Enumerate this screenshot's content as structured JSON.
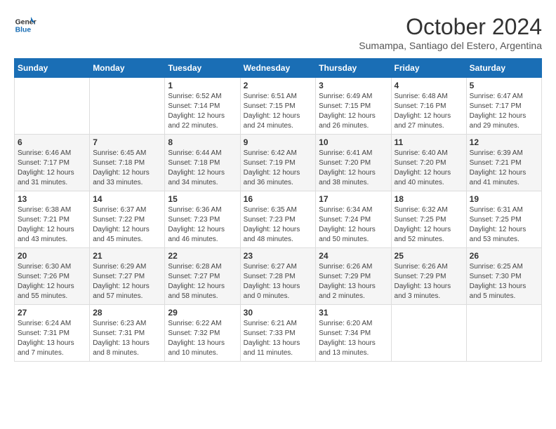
{
  "logo": {
    "text_general": "General",
    "text_blue": "Blue"
  },
  "header": {
    "month": "October 2024",
    "location": "Sumampa, Santiago del Estero, Argentina"
  },
  "weekdays": [
    "Sunday",
    "Monday",
    "Tuesday",
    "Wednesday",
    "Thursday",
    "Friday",
    "Saturday"
  ],
  "weeks": [
    [
      {
        "day": "",
        "info": ""
      },
      {
        "day": "",
        "info": ""
      },
      {
        "day": "1",
        "info": "Sunrise: 6:52 AM\nSunset: 7:14 PM\nDaylight: 12 hours and 22 minutes."
      },
      {
        "day": "2",
        "info": "Sunrise: 6:51 AM\nSunset: 7:15 PM\nDaylight: 12 hours and 24 minutes."
      },
      {
        "day": "3",
        "info": "Sunrise: 6:49 AM\nSunset: 7:15 PM\nDaylight: 12 hours and 26 minutes."
      },
      {
        "day": "4",
        "info": "Sunrise: 6:48 AM\nSunset: 7:16 PM\nDaylight: 12 hours and 27 minutes."
      },
      {
        "day": "5",
        "info": "Sunrise: 6:47 AM\nSunset: 7:17 PM\nDaylight: 12 hours and 29 minutes."
      }
    ],
    [
      {
        "day": "6",
        "info": "Sunrise: 6:46 AM\nSunset: 7:17 PM\nDaylight: 12 hours and 31 minutes."
      },
      {
        "day": "7",
        "info": "Sunrise: 6:45 AM\nSunset: 7:18 PM\nDaylight: 12 hours and 33 minutes."
      },
      {
        "day": "8",
        "info": "Sunrise: 6:44 AM\nSunset: 7:18 PM\nDaylight: 12 hours and 34 minutes."
      },
      {
        "day": "9",
        "info": "Sunrise: 6:42 AM\nSunset: 7:19 PM\nDaylight: 12 hours and 36 minutes."
      },
      {
        "day": "10",
        "info": "Sunrise: 6:41 AM\nSunset: 7:20 PM\nDaylight: 12 hours and 38 minutes."
      },
      {
        "day": "11",
        "info": "Sunrise: 6:40 AM\nSunset: 7:20 PM\nDaylight: 12 hours and 40 minutes."
      },
      {
        "day": "12",
        "info": "Sunrise: 6:39 AM\nSunset: 7:21 PM\nDaylight: 12 hours and 41 minutes."
      }
    ],
    [
      {
        "day": "13",
        "info": "Sunrise: 6:38 AM\nSunset: 7:21 PM\nDaylight: 12 hours and 43 minutes."
      },
      {
        "day": "14",
        "info": "Sunrise: 6:37 AM\nSunset: 7:22 PM\nDaylight: 12 hours and 45 minutes."
      },
      {
        "day": "15",
        "info": "Sunrise: 6:36 AM\nSunset: 7:23 PM\nDaylight: 12 hours and 46 minutes."
      },
      {
        "day": "16",
        "info": "Sunrise: 6:35 AM\nSunset: 7:23 PM\nDaylight: 12 hours and 48 minutes."
      },
      {
        "day": "17",
        "info": "Sunrise: 6:34 AM\nSunset: 7:24 PM\nDaylight: 12 hours and 50 minutes."
      },
      {
        "day": "18",
        "info": "Sunrise: 6:32 AM\nSunset: 7:25 PM\nDaylight: 12 hours and 52 minutes."
      },
      {
        "day": "19",
        "info": "Sunrise: 6:31 AM\nSunset: 7:25 PM\nDaylight: 12 hours and 53 minutes."
      }
    ],
    [
      {
        "day": "20",
        "info": "Sunrise: 6:30 AM\nSunset: 7:26 PM\nDaylight: 12 hours and 55 minutes."
      },
      {
        "day": "21",
        "info": "Sunrise: 6:29 AM\nSunset: 7:27 PM\nDaylight: 12 hours and 57 minutes."
      },
      {
        "day": "22",
        "info": "Sunrise: 6:28 AM\nSunset: 7:27 PM\nDaylight: 12 hours and 58 minutes."
      },
      {
        "day": "23",
        "info": "Sunrise: 6:27 AM\nSunset: 7:28 PM\nDaylight: 13 hours and 0 minutes."
      },
      {
        "day": "24",
        "info": "Sunrise: 6:26 AM\nSunset: 7:29 PM\nDaylight: 13 hours and 2 minutes."
      },
      {
        "day": "25",
        "info": "Sunrise: 6:26 AM\nSunset: 7:29 PM\nDaylight: 13 hours and 3 minutes."
      },
      {
        "day": "26",
        "info": "Sunrise: 6:25 AM\nSunset: 7:30 PM\nDaylight: 13 hours and 5 minutes."
      }
    ],
    [
      {
        "day": "27",
        "info": "Sunrise: 6:24 AM\nSunset: 7:31 PM\nDaylight: 13 hours and 7 minutes."
      },
      {
        "day": "28",
        "info": "Sunrise: 6:23 AM\nSunset: 7:31 PM\nDaylight: 13 hours and 8 minutes."
      },
      {
        "day": "29",
        "info": "Sunrise: 6:22 AM\nSunset: 7:32 PM\nDaylight: 13 hours and 10 minutes."
      },
      {
        "day": "30",
        "info": "Sunrise: 6:21 AM\nSunset: 7:33 PM\nDaylight: 13 hours and 11 minutes."
      },
      {
        "day": "31",
        "info": "Sunrise: 6:20 AM\nSunset: 7:34 PM\nDaylight: 13 hours and 13 minutes."
      },
      {
        "day": "",
        "info": ""
      },
      {
        "day": "",
        "info": ""
      }
    ]
  ]
}
